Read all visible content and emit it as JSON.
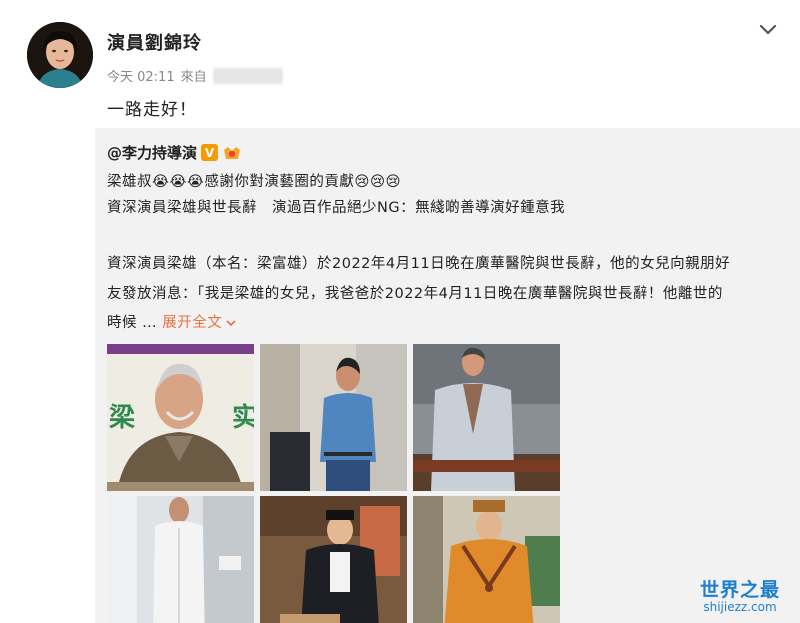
{
  "post": {
    "author_name": "演員劉錦玲",
    "time": "今天 02:11",
    "source_prefix": "來自",
    "text": "一路走好！"
  },
  "repost": {
    "author": "@李力持導演",
    "line1": "梁雄叔😭😭😭感謝你對演藝圈的貢獻😢😢😢",
    "line2": "資深演員梁雄與世長辭　演過百作品絕少NG：無綫啲善導演好鍾意我",
    "body_line1": "資深演員梁雄（本名：梁富雄）於2022年4月11日晚在廣華醫院與世長辭，他的女兒向親朋好",
    "body_line2": "友發放消息：「我是梁雄的女兒，我爸爸於2022年4月11日晚在廣華醫院與世長辭！他離世的",
    "body_line3_prefix": "時候 …",
    "expand_label": "展开全文"
  },
  "thumbs": [
    {
      "name": "photo-1",
      "label": "梁"
    },
    {
      "name": "photo-2",
      "label": ""
    },
    {
      "name": "photo-3",
      "label": ""
    },
    {
      "name": "photo-4",
      "label": ""
    },
    {
      "name": "photo-5",
      "label": ""
    },
    {
      "name": "photo-6",
      "label": ""
    }
  ],
  "watermark": {
    "title": "世界之最",
    "url": "shijiezz.com"
  },
  "colors": {
    "accent": "#eb7340",
    "repost_bg": "#f2f2f2",
    "vip_badge": "#f59b00",
    "watermark": "#1e7fd0"
  },
  "icons": [
    "chevron-down-icon",
    "verified-v-icon",
    "member-badge-icon"
  ]
}
